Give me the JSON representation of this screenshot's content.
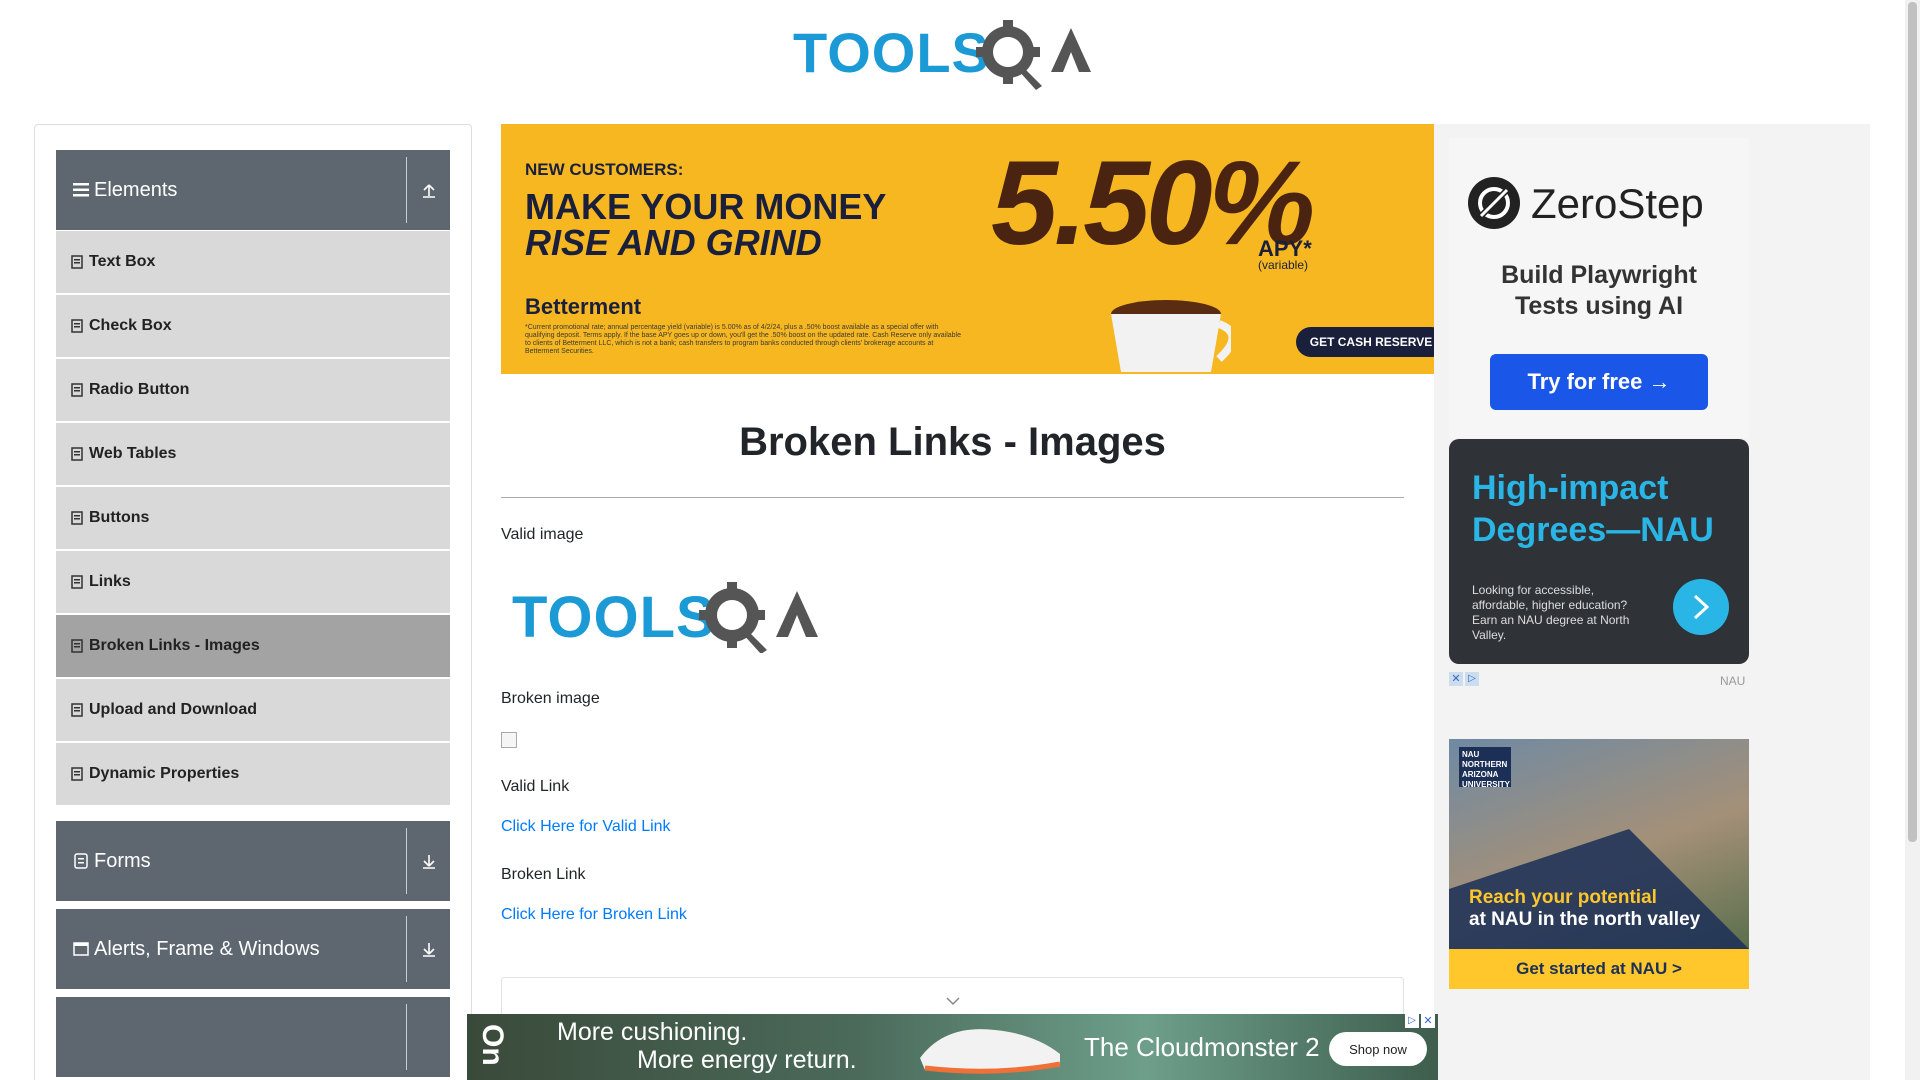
{
  "header": {
    "logo_text": "TOOLSQA"
  },
  "sidebar": {
    "groups": [
      {
        "label": "Elements"
      },
      {
        "label": "Forms"
      },
      {
        "label": "Alerts, Frame & Windows"
      }
    ],
    "items": [
      {
        "label": "Text Box"
      },
      {
        "label": "Check Box"
      },
      {
        "label": "Radio Button"
      },
      {
        "label": "Web Tables"
      },
      {
        "label": "Buttons"
      },
      {
        "label": "Links"
      },
      {
        "label": "Broken Links - Images",
        "active": true
      },
      {
        "label": "Upload and Download"
      },
      {
        "label": "Dynamic Properties"
      }
    ]
  },
  "ads": {
    "top_banner": {
      "eyebrow": "NEW CUSTOMERS:",
      "headline1": "MAKE YOUR MONEY",
      "headline2": "RISE AND GRIND",
      "brand": "Betterment",
      "rate": "5.50%",
      "apy": "APY*",
      "apy_note": "(variable)",
      "cta": "GET CASH RESERVE",
      "fine_print": "*Current promotional rate; annual percentage yield (variable) is 5.00% as of 4/2/24, plus a .50% boost available as a special offer with qualifying deposit. Terms apply. If the base APY goes up or down, you'll get the .50% boost on the updated rate. Cash Reserve only available to clients of Betterment LLC, which is not a bank; cash transfers to program banks conducted through clients' brokerage accounts at Betterment Securities."
    },
    "zerostep": {
      "brand": "ZeroStep",
      "tagline": "Build Playwright Tests using AI",
      "cta": "Try for free →"
    },
    "nau1": {
      "headline": "High-impact Degrees—NAU",
      "body": "Looking for accessible, affordable, higher education? Earn an NAU degree at North Valley.",
      "source": "NAU"
    },
    "nau2": {
      "badge": "NAU NORTHERN ARIZONA UNIVERSITY",
      "headline1": "Reach your potential",
      "headline2": "at NAU in the north valley",
      "cta": "Get started at NAU >"
    },
    "bottom": {
      "line1": "More cushioning.",
      "line2": "More energy return.",
      "product": "The Cloudmonster 2",
      "cta": "Shop now"
    }
  },
  "main": {
    "title": "Broken Links - Images",
    "valid_image_label": "Valid image",
    "broken_image_label": "Broken image",
    "valid_link_label": "Valid Link",
    "valid_link_text": "Click Here for Valid Link",
    "broken_link_label": "Broken Link",
    "broken_link_text": "Click Here for Broken Link"
  },
  "colors": {
    "brand_blue": "#1b9ad6",
    "sidebar_header": "#5e6770",
    "sidebar_item": "#d9d9d9",
    "link": "#007bff"
  }
}
